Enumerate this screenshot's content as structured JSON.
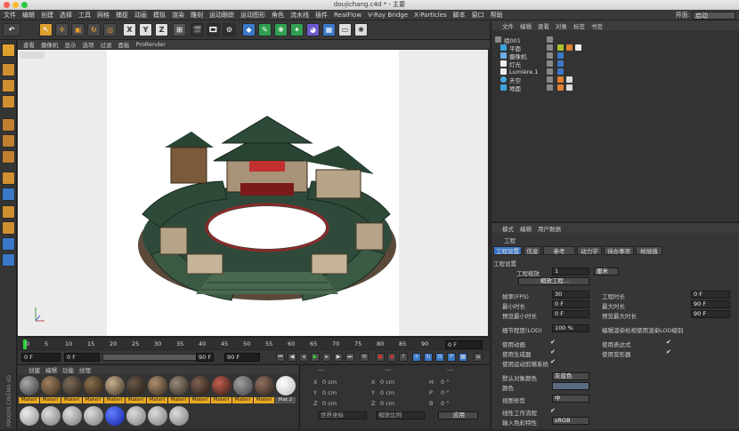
{
  "window": {
    "title": "doujichang.c4d * - 主要"
  },
  "menubar": {
    "items": [
      "文件",
      "编辑",
      "创建",
      "选择",
      "工具",
      "网格",
      "捕捉",
      "动画",
      "模拟",
      "渲染",
      "雕刻",
      "运动跟踪",
      "运动图形",
      "角色",
      "流水线",
      "插件",
      "RealFlow",
      "V-Ray Bridge",
      "X-Particles",
      "脚本",
      "窗口",
      "帮助"
    ],
    "layout_label": "界面:",
    "layout_value": "启动"
  },
  "viewport_menu": [
    "查看",
    "摄像机",
    "显示",
    "选项",
    "过滤",
    "面板",
    "ProRender"
  ],
  "timeline": {
    "ticks": [
      "0",
      "5",
      "10",
      "15",
      "20",
      "25",
      "30",
      "35",
      "40",
      "45",
      "50",
      "55",
      "60",
      "65",
      "70",
      "75",
      "80",
      "85",
      "90"
    ],
    "frame_field": "0 F"
  },
  "transport": {
    "start_field": "0 F",
    "start2_field": "0 F",
    "end_field": "90 F",
    "end2_field": "90 F"
  },
  "material_panel": {
    "menu": [
      "创建",
      "编辑",
      "功能",
      "纹理"
    ],
    "labels": [
      "Materi",
      "Materi",
      "Materi",
      "Materi",
      "Materi",
      "Materi",
      "Materi",
      "Materi",
      "Materi",
      "Materi",
      "Materi",
      "Materi",
      "Mat.2"
    ]
  },
  "coord_panel": {
    "header": [
      "---",
      "---",
      "---"
    ],
    "rows": [
      {
        "a": "X",
        "av": "0 cm",
        "b": "X",
        "bv": "0 cm",
        "c": "H",
        "cv": "0 °"
      },
      {
        "a": "Y",
        "av": "0 cm",
        "b": "Y",
        "bv": "0 cm",
        "c": "P",
        "cv": "0 °"
      },
      {
        "a": "Z",
        "av": "0 cm",
        "b": "Z",
        "bv": "0 cm",
        "c": "B",
        "cv": "0 °"
      }
    ],
    "world_select": "世界坐标",
    "scale_select": "缩放比例",
    "apply_button": "应用"
  },
  "object_panel": {
    "menu": [
      "文件",
      "编辑",
      "查看",
      "对象",
      "标签",
      "书签"
    ],
    "objects": [
      {
        "name": "组001",
        "color": "#8a8a8a"
      },
      {
        "name": "平面",
        "color": "#3da3e0"
      },
      {
        "name": "摄像机",
        "color": "#6ab0e0"
      },
      {
        "name": "灯光",
        "color": "#f0f0f0"
      },
      {
        "name": "Lumière.1",
        "color": "#f0f0f0"
      },
      {
        "name": "天空",
        "color": "#4aa8e0"
      },
      {
        "name": "地面",
        "color": "#3da3e0"
      }
    ]
  },
  "attr_panel": {
    "menu": [
      "模式",
      "编辑",
      "用户数据"
    ],
    "heading": "工程",
    "tabs": [
      "工程设置",
      "信息",
      "参考",
      "动力学",
      "待办事项",
      "帧插值"
    ],
    "section": "工程设置",
    "project_scale_label": "工程缩放",
    "project_scale_value": "1",
    "project_scale_unit": "厘米",
    "scale_button": "缩放工程...",
    "fps_label": "帧率(FPS)",
    "fps_value": "30",
    "min_time_label": "最小时长",
    "min_time_value": "0 F",
    "preview_min_label": "预览最小时长",
    "preview_min_value": "0 F",
    "lod_label": "细节程度(LOD)",
    "lod_value": "100 %",
    "proj_time_label": "工程时长",
    "proj_time_value": "0 F",
    "max_time_label": "最大时长",
    "max_time_value": "90 F",
    "preview_max_label": "预览最大时长",
    "preview_max_value": "90 F",
    "render_lod_label": "编辑渲染检视使用渲染LOD级别",
    "use_anim": "使用动画",
    "use_expr": "使用表达式",
    "use_gen": "使用生成器",
    "use_deform": "使用变形器",
    "use_mograph": "使用运动剪辑系统",
    "default_color_label": "默认对象颜色",
    "default_color_value": "灰蓝色",
    "color_label": "颜色",
    "view_clip_label": "视图修剪",
    "view_clip_value": "中",
    "linear_label": "线性工作流程",
    "input_color_label": "输入色彩特性",
    "input_color_value": "sRGB"
  },
  "colors": {
    "accent_blue": "#3a78c8",
    "material_label": "#e8a820",
    "timeline_green": "#30d040"
  }
}
